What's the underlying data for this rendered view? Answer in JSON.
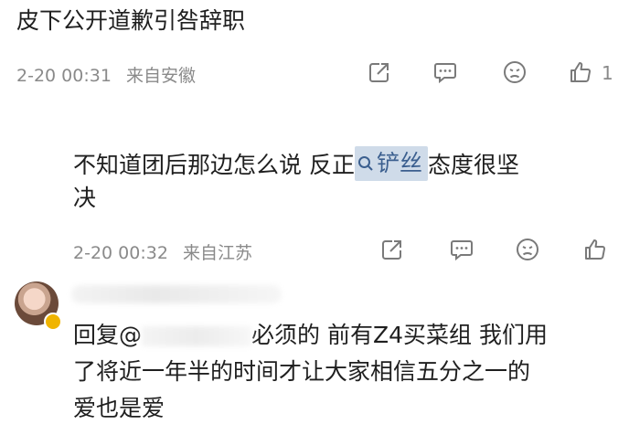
{
  "comment1": {
    "text": "皮下公开道歉引咎辞职",
    "time": "2-20 00:31",
    "location": "来自安徽",
    "like_count": "1"
  },
  "comment2": {
    "text_part1": "不知道团后那边怎么说 反正",
    "topic": "铲丝",
    "text_part2": "态度很坚",
    "text_line2": "决",
    "time": "2-20 00:32",
    "location": "来自江苏"
  },
  "reply": {
    "prefix": "回复@",
    "line1_rest": "必须的 前有Z4买菜组 我们用",
    "line2": "了将近一年半的时间才让大家相信五分之一的",
    "line3": "爱也是爱"
  },
  "icons": {
    "share": "share-icon",
    "comment": "comment-icon",
    "react": "face-icon",
    "like": "thumbs-up-icon",
    "topic": "search-icon"
  },
  "colors": {
    "topic_bg": "#cfdbe9",
    "topic_text": "#3b5f8f",
    "meta": "#8a8a8a"
  }
}
